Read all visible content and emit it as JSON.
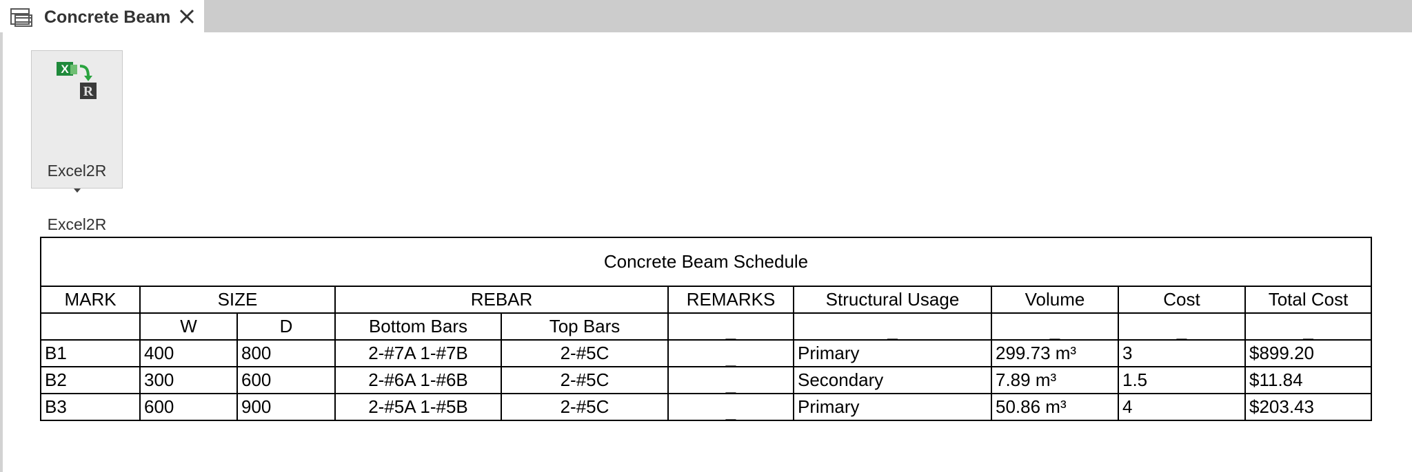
{
  "tab": {
    "title": "Concrete Beam"
  },
  "ribbon": {
    "button_label": "Excel2R",
    "group_label": "Excel2R"
  },
  "schedule": {
    "title": "Concrete Beam Schedule",
    "headers": {
      "mark": "MARK",
      "size": "SIZE",
      "rebar": "REBAR",
      "remarks": "REMARKS",
      "usage": "Structural Usage",
      "volume": "Volume",
      "cost": "Cost",
      "total_cost": "Total Cost"
    },
    "subheaders": {
      "w": "W",
      "d": "D",
      "bottom_bars": "Bottom Bars",
      "top_bars": "Top Bars",
      "placeholder": "_"
    },
    "rows": [
      {
        "mark": "B1",
        "w": "400",
        "d": "800",
        "bottom": "2-#7A 1-#7B",
        "top": "2-#5C",
        "remarks": "_",
        "usage": "Primary",
        "volume": "299.73 m³",
        "cost": "3",
        "total": "$899.20"
      },
      {
        "mark": "B2",
        "w": "300",
        "d": "600",
        "bottom": "2-#6A 1-#6B",
        "top": "2-#5C",
        "remarks": "_",
        "usage": "Secondary",
        "volume": "7.89 m³",
        "cost": "1.5",
        "total": "$11.84"
      },
      {
        "mark": "B3",
        "w": "600",
        "d": "900",
        "bottom": "2-#5A 1-#5B",
        "top": "2-#5C",
        "remarks": "_",
        "usage": "Primary",
        "volume": "50.86 m³",
        "cost": "4",
        "total": "$203.43"
      }
    ]
  },
  "icons": {
    "tab": "schedule-view-icon",
    "close": "close-icon",
    "button": "excel-to-revit-icon",
    "dropdown": "dropdown-arrow-icon"
  },
  "colors": {
    "tabbar_bg": "#cccccc",
    "button_bg": "#ebebeb",
    "excel_green": "#1f8a3b",
    "border": "#000000"
  }
}
